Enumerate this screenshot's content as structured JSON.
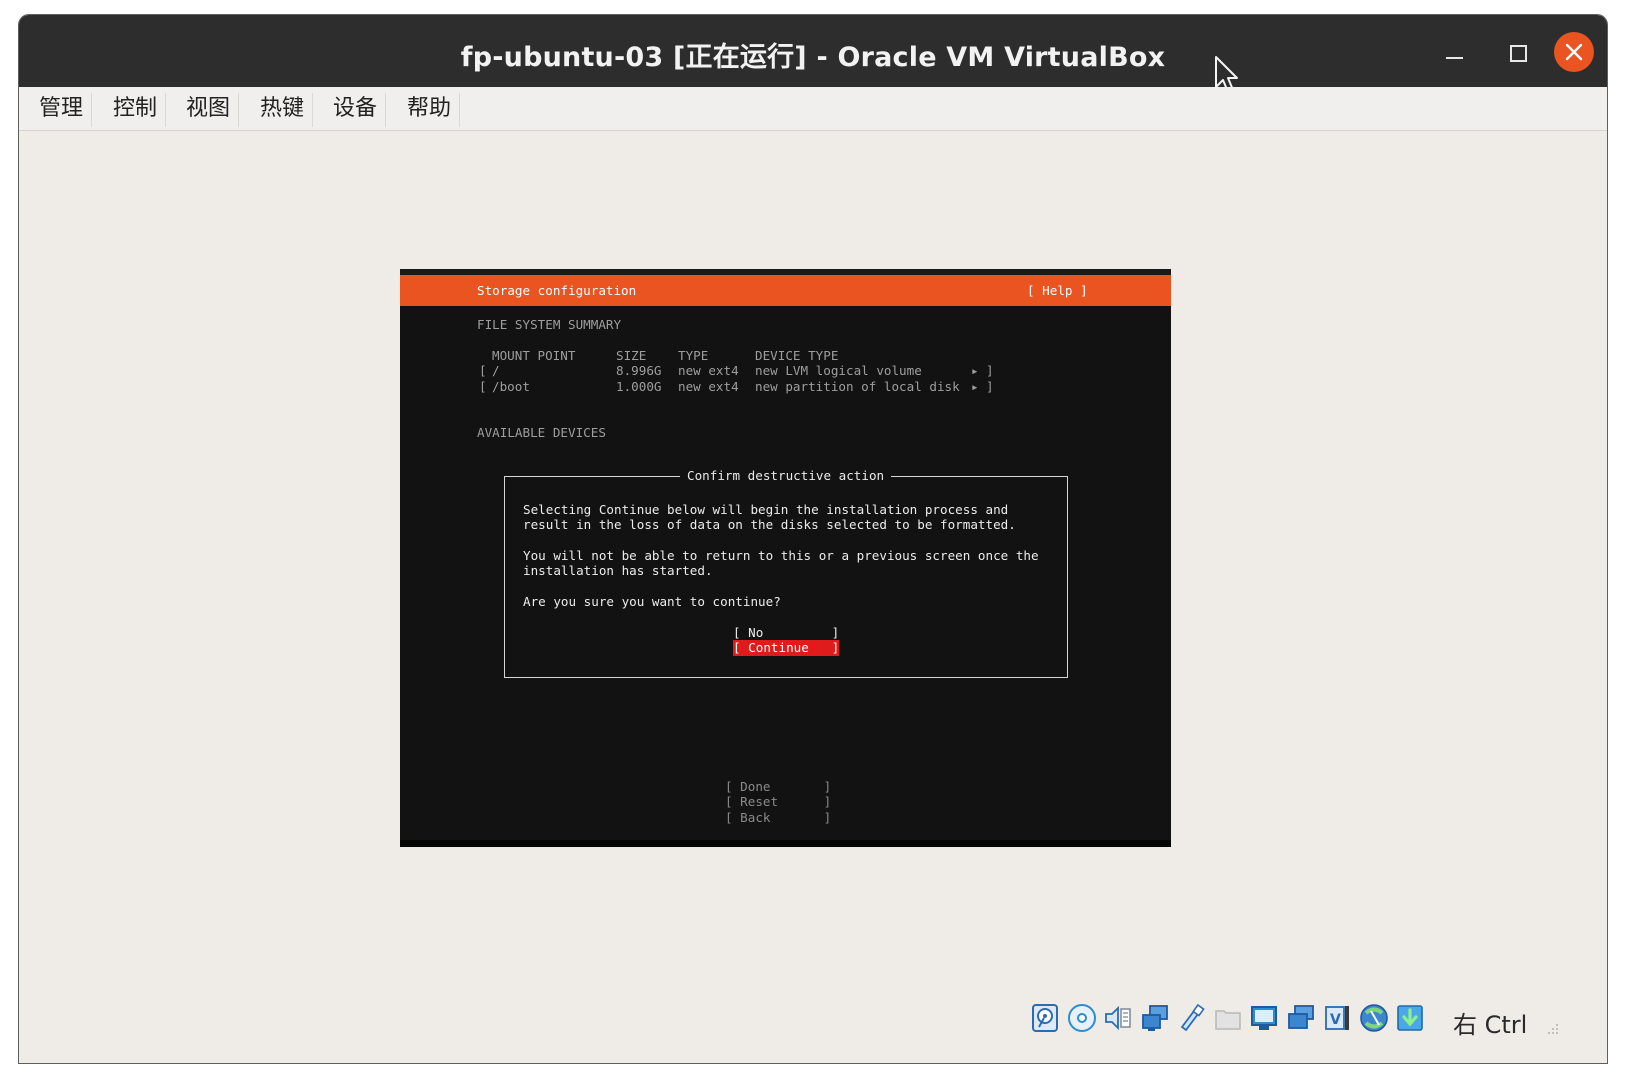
{
  "window": {
    "title": "fp-ubuntu-03 [正在运行] - Oracle VM VirtualBox"
  },
  "menu": [
    {
      "label": "管理"
    },
    {
      "label": "控制"
    },
    {
      "label": "视图"
    },
    {
      "label": "热键"
    },
    {
      "label": "设备"
    },
    {
      "label": "帮助"
    }
  ],
  "installer": {
    "header_title": "Storage configuration",
    "help_button": "[ Help ]",
    "fs_summary_heading": "FILE SYSTEM SUMMARY",
    "columns": [
      "MOUNT POINT",
      "SIZE",
      "TYPE",
      "DEVICE TYPE"
    ],
    "rows": [
      {
        "open": "[",
        "mount": "/",
        "size": "8.996G",
        "type": "new ext4",
        "device": "new LVM logical volume",
        "arrow": "▸",
        "close": "]"
      },
      {
        "open": "[",
        "mount": "/boot",
        "size": "1.000G",
        "type": "new ext4",
        "device": "new partition of local disk",
        "arrow": "▸",
        "close": "]"
      }
    ],
    "available_heading": "AVAILABLE DEVICES",
    "dialog": {
      "title": "Confirm destructive action",
      "para1_line1": "Selecting Continue below will begin the installation process and",
      "para1_line2": "result in the loss of data on the disks selected to be formatted.",
      "para2_line1": "You will not be able to return to this or a previous screen once the",
      "para2_line2": "installation has started.",
      "question": "Are you sure you want to continue?",
      "no_button": "[ No         ]",
      "continue_button": "[ Continue   ]"
    },
    "bottom_buttons": {
      "done": "[ Done       ]",
      "reset": "[ Reset      ]",
      "back": "[ Back       ]"
    }
  },
  "statusbar": {
    "icons": [
      "hard-disk-icon",
      "optical-drive-icon",
      "audio-icon",
      "network-icon",
      "usb-icon",
      "shared-folders-icon",
      "display-icon",
      "video-capture-icon",
      "recording-icon",
      "vt-x-icon",
      "mouse-integration-icon",
      "host-key-icon"
    ],
    "host_key": "右 Ctrl"
  },
  "colors": {
    "ubuntu_orange": "#e95420",
    "selected_button": "#e01b1b",
    "console_bg": "#121212",
    "titlebar_bg": "#2d2d2d"
  }
}
